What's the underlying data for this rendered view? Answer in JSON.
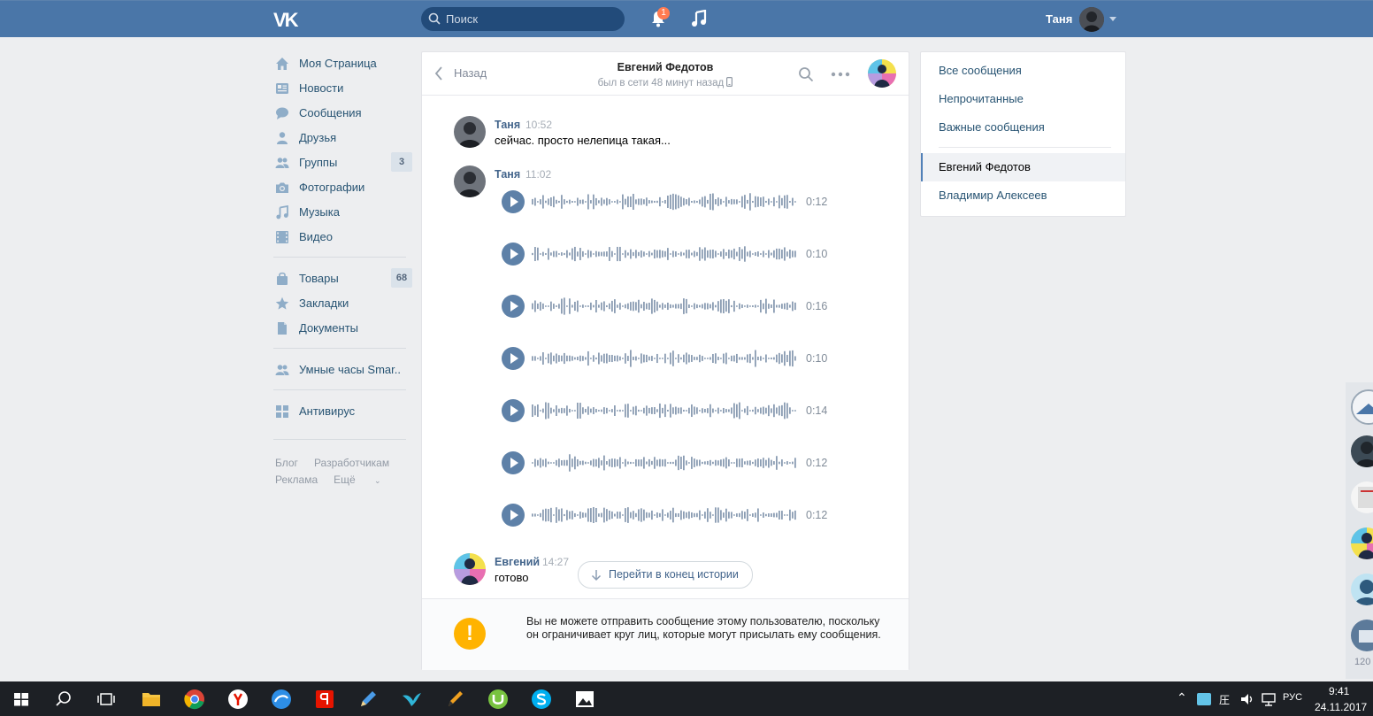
{
  "header": {
    "logo": "VK",
    "search_placeholder": "Поиск",
    "notifications_count": "1",
    "user_name": "Таня"
  },
  "left_nav": {
    "items": [
      {
        "label": "Моя Страница",
        "icon": "home-icon"
      },
      {
        "label": "Новости",
        "icon": "news-icon"
      },
      {
        "label": "Сообщения",
        "icon": "messages-icon"
      },
      {
        "label": "Друзья",
        "icon": "friends-icon"
      },
      {
        "label": "Группы",
        "icon": "groups-icon",
        "badge": "3"
      },
      {
        "label": "Фотографии",
        "icon": "camera-icon"
      },
      {
        "label": "Музыка",
        "icon": "music-icon"
      },
      {
        "label": "Видео",
        "icon": "video-icon"
      },
      {
        "label": "Товары",
        "icon": "bag-icon",
        "badge": "68"
      },
      {
        "label": "Закладки",
        "icon": "star-icon"
      },
      {
        "label": "Документы",
        "icon": "document-icon"
      },
      {
        "label": "Умные часы Smar..",
        "icon": "group-app-icon"
      },
      {
        "label": "Антивирус",
        "icon": "apps-icon"
      }
    ],
    "footer": [
      "Блог",
      "Разработчикам",
      "Реклама",
      "Ещё"
    ]
  },
  "chat": {
    "back_label": "Назад",
    "contact_name": "Евгений Федотов",
    "contact_status": "был в сети 48 минут назад",
    "messages": [
      {
        "author": "Таня",
        "time": "10:52",
        "text": "сейчас. просто нелепица такая..."
      },
      {
        "author": "Таня",
        "time": "11:02",
        "voice": [
          "0:12",
          "0:10",
          "0:16",
          "0:10",
          "0:14",
          "0:12",
          "0:12"
        ]
      },
      {
        "author": "Евгений",
        "time": "14:27",
        "text": "готово"
      }
    ],
    "jump_label": "Перейти в конец истории",
    "warning": "Вы не можете отправить сообщение этому пользователю, поскольку он ограничивает круг лиц, которые могут присылать ему сообщения."
  },
  "right_panel": {
    "filters": [
      "Все сообщения",
      "Непрочитанные",
      "Важные сообщения"
    ],
    "chats": [
      {
        "label": "Евгений Федотов",
        "active": true
      },
      {
        "label": "Владимир Алексеев",
        "active": false
      }
    ]
  },
  "right_sidebar": {
    "count": "120"
  },
  "taskbar": {
    "time": "9:41",
    "date": "24.11.2017",
    "language": "РУС"
  },
  "colors": {
    "header_bg": "#4a76a8",
    "link": "#285473",
    "author": "#42648b",
    "voice_play": "#5e81a8",
    "warning": "#ffb300"
  }
}
